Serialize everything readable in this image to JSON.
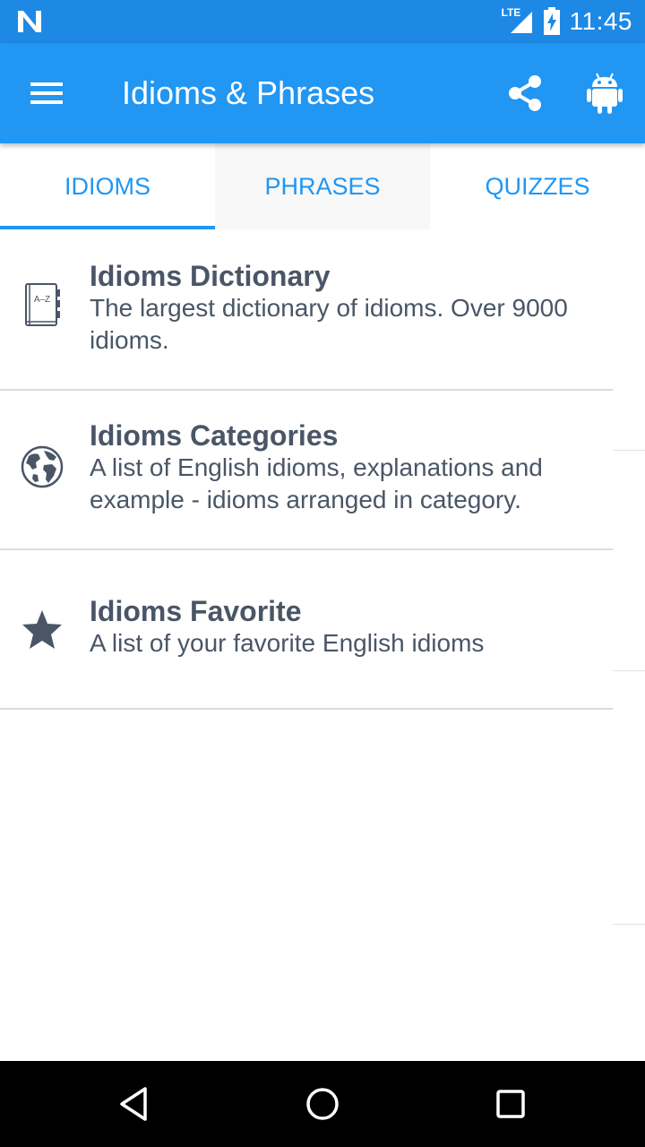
{
  "status_bar": {
    "network": "LTE",
    "time": "11:45"
  },
  "app_bar": {
    "title": "Idioms & Phrases",
    "menu_icon": "hamburger-menu-icon",
    "share_icon": "share-icon",
    "android_icon": "android-icon"
  },
  "tabs": [
    {
      "label": "IDIOMS",
      "selected": true
    },
    {
      "label": "PHRASES",
      "selected": false
    },
    {
      "label": "QUIZZES",
      "selected": false
    }
  ],
  "list": [
    {
      "icon": "az-dictionary-book-icon",
      "title": "Idioms Dictionary",
      "description": "The largest dictionary of idioms. Over 9000 idioms."
    },
    {
      "icon": "globe-icon",
      "title": "Idioms Categories",
      "description": "A list of English idioms, explanations and example - idioms arranged in category."
    },
    {
      "icon": "star-icon",
      "title": "Idioms Favorite",
      "description": "A list of your favorite English idioms"
    }
  ],
  "book_icon_text": "A–Z",
  "nav_bar": {
    "back_icon": "back-triangle-icon",
    "home_icon": "home-circle-icon",
    "recents_icon": "recents-square-icon"
  },
  "colors": {
    "status_bar": "#1e88e5",
    "app_bar": "#2196f3",
    "accent": "#2196f3",
    "text": "#4a5666",
    "divider": "#dcdcdc"
  }
}
